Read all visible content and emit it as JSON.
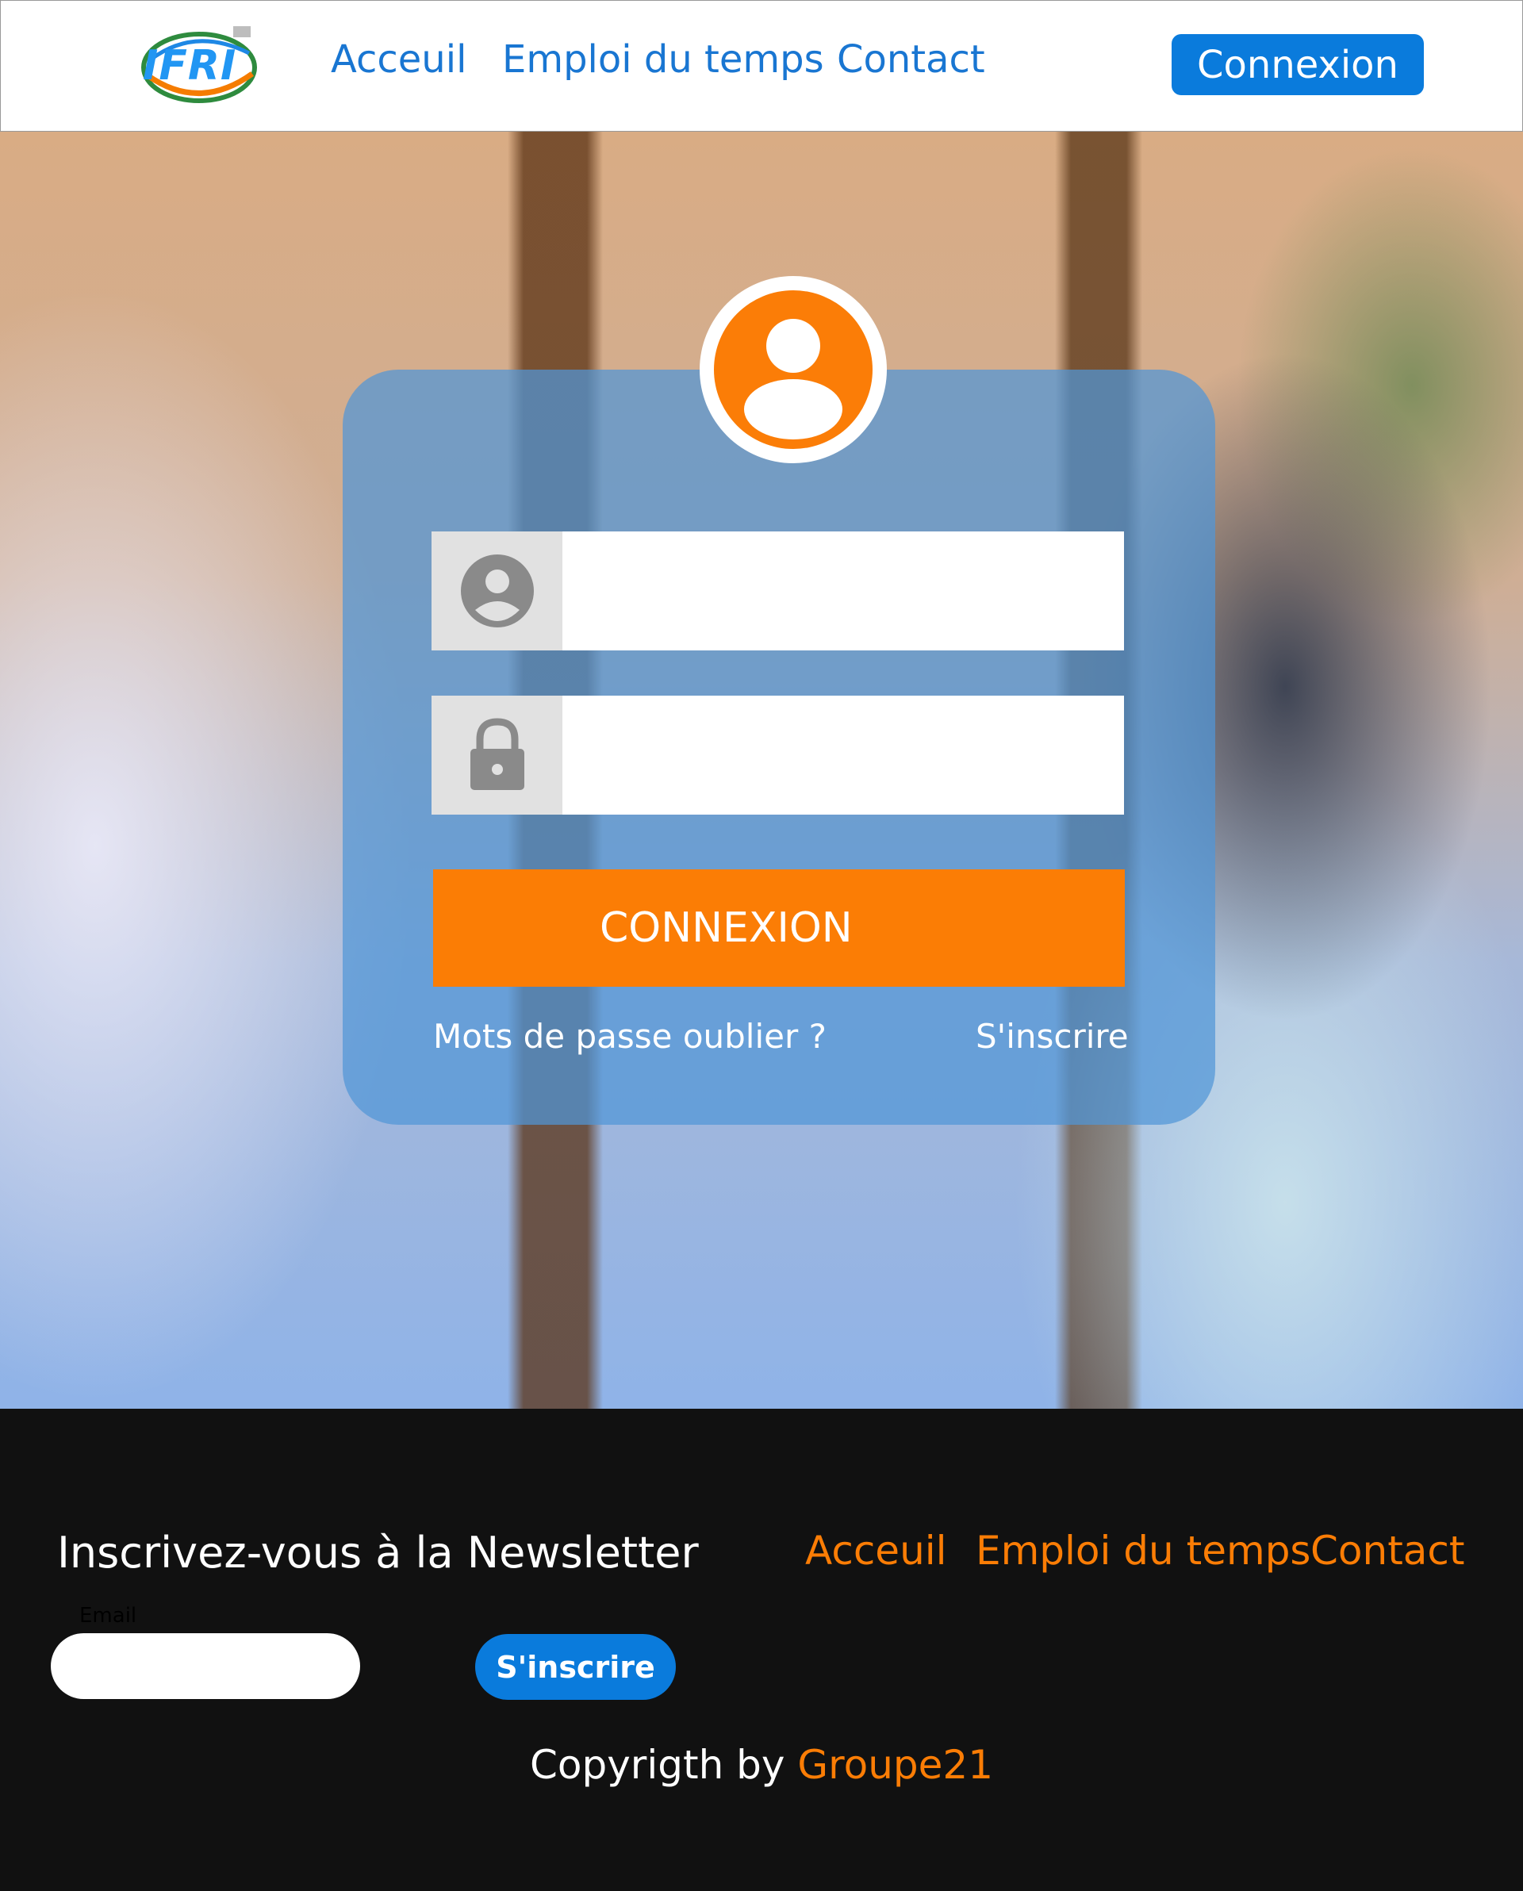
{
  "header": {
    "logo_text": "IFRI",
    "nav": [
      {
        "label": "Acceuil"
      },
      {
        "label": "Emploi du temps"
      },
      {
        "label": "Contact"
      }
    ],
    "login_button": "Connexion"
  },
  "login_card": {
    "username": {
      "value": "",
      "placeholder": "",
      "icon": "user-circle-icon"
    },
    "password": {
      "value": "",
      "placeholder": "",
      "icon": "lock-icon"
    },
    "submit_label": "CONNEXION",
    "forgot_label": "Mots de passe oublier ?",
    "signup_label": "S'inscrire",
    "avatar_icon": "user-avatar-icon"
  },
  "footer": {
    "newsletter_title": "Inscrivez-vous à la Newsletter",
    "links": [
      {
        "label": "Acceuil"
      },
      {
        "label": "Emploi du temps"
      },
      {
        "label": "Contact"
      }
    ],
    "email_label": "Email",
    "email_value": "",
    "subscribe_label": "S'inscrire",
    "copyright_prefix": "Copyrigth by ",
    "copyright_brand": "Groupe21"
  },
  "colors": {
    "primary_blue": "#0a7bdc",
    "accent_orange": "#fb7d05",
    "footer_bg": "#111111"
  }
}
